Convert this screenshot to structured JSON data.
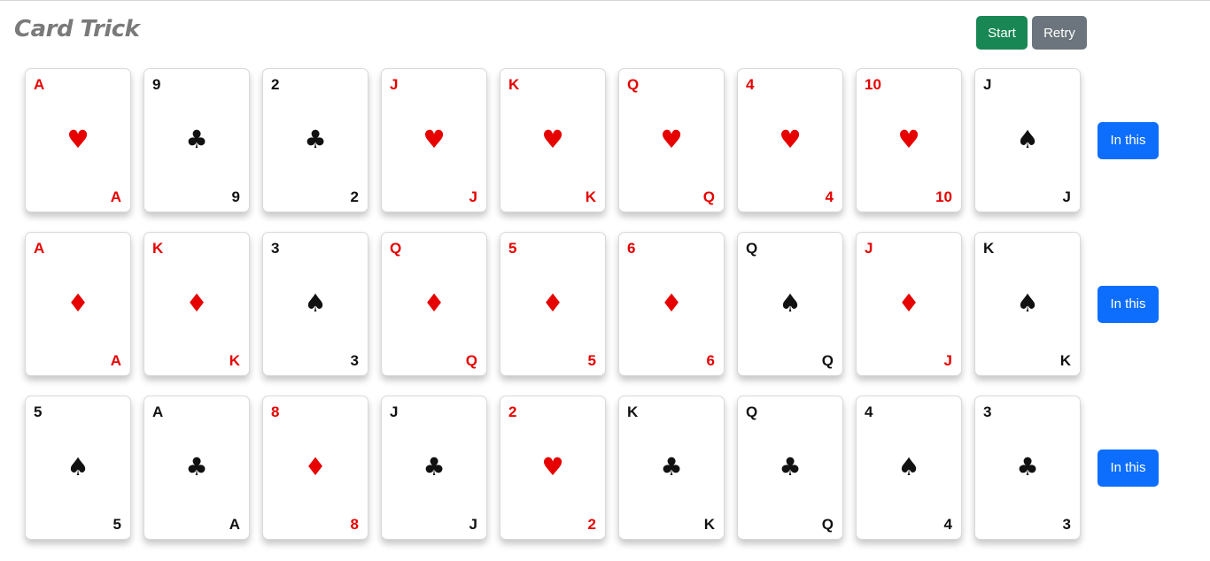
{
  "header": {
    "title": "Card Trick",
    "start_label": "Start",
    "retry_label": "Retry"
  },
  "colors": {
    "red": "#e60000",
    "black": "#111111",
    "start": "#198754",
    "retry": "#6c757d",
    "pick": "#0d6efd"
  },
  "rows": [
    {
      "button_label": "In this",
      "cards": [
        {
          "rank": "A",
          "suit": "♥",
          "suit_name": "hearts",
          "color": "red"
        },
        {
          "rank": "9",
          "suit": "♣",
          "suit_name": "clubs",
          "color": "black"
        },
        {
          "rank": "2",
          "suit": "♣",
          "suit_name": "clubs",
          "color": "black"
        },
        {
          "rank": "J",
          "suit": "♥",
          "suit_name": "hearts",
          "color": "red"
        },
        {
          "rank": "K",
          "suit": "♥",
          "suit_name": "hearts",
          "color": "red"
        },
        {
          "rank": "Q",
          "suit": "♥",
          "suit_name": "hearts",
          "color": "red"
        },
        {
          "rank": "4",
          "suit": "♥",
          "suit_name": "hearts",
          "color": "red"
        },
        {
          "rank": "10",
          "suit": "♥",
          "suit_name": "hearts",
          "color": "red"
        },
        {
          "rank": "J",
          "suit": "♠",
          "suit_name": "spades",
          "color": "black"
        }
      ]
    },
    {
      "button_label": "In this",
      "cards": [
        {
          "rank": "A",
          "suit": "♦",
          "suit_name": "diamonds",
          "color": "red"
        },
        {
          "rank": "K",
          "suit": "♦",
          "suit_name": "diamonds",
          "color": "red"
        },
        {
          "rank": "3",
          "suit": "♠",
          "suit_name": "spades",
          "color": "black"
        },
        {
          "rank": "Q",
          "suit": "♦",
          "suit_name": "diamonds",
          "color": "red"
        },
        {
          "rank": "5",
          "suit": "♦",
          "suit_name": "diamonds",
          "color": "red"
        },
        {
          "rank": "6",
          "suit": "♦",
          "suit_name": "diamonds",
          "color": "red"
        },
        {
          "rank": "Q",
          "suit": "♠",
          "suit_name": "spades",
          "color": "black"
        },
        {
          "rank": "J",
          "suit": "♦",
          "suit_name": "diamonds",
          "color": "red"
        },
        {
          "rank": "K",
          "suit": "♠",
          "suit_name": "spades",
          "color": "black"
        }
      ]
    },
    {
      "button_label": "In this",
      "cards": [
        {
          "rank": "5",
          "suit": "♠",
          "suit_name": "spades",
          "color": "black"
        },
        {
          "rank": "A",
          "suit": "♣",
          "suit_name": "clubs",
          "color": "black"
        },
        {
          "rank": "8",
          "suit": "♦",
          "suit_name": "diamonds",
          "color": "red"
        },
        {
          "rank": "J",
          "suit": "♣",
          "suit_name": "clubs",
          "color": "black"
        },
        {
          "rank": "2",
          "suit": "♥",
          "suit_name": "hearts",
          "color": "red"
        },
        {
          "rank": "K",
          "suit": "♣",
          "suit_name": "clubs",
          "color": "black"
        },
        {
          "rank": "Q",
          "suit": "♣",
          "suit_name": "clubs",
          "color": "black"
        },
        {
          "rank": "4",
          "suit": "♠",
          "suit_name": "spades",
          "color": "black"
        },
        {
          "rank": "3",
          "suit": "♣",
          "suit_name": "clubs",
          "color": "black"
        }
      ]
    }
  ]
}
